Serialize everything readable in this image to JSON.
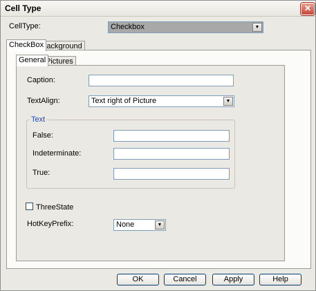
{
  "window": {
    "title": "Cell Type"
  },
  "celltype": {
    "label": "CellType:",
    "value": "Checkbox"
  },
  "outer_tabs": [
    {
      "label": "CheckBox"
    },
    {
      "label": "Background"
    }
  ],
  "inner_tabs": [
    {
      "label": "General"
    },
    {
      "label": "Pictures"
    }
  ],
  "general": {
    "caption_label": "Caption:",
    "caption_value": "",
    "textalign_label": "TextAlign:",
    "textalign_value": "Text right of Picture",
    "text_group": {
      "legend": "Text",
      "false_label": "False:",
      "false_value": "",
      "indeterminate_label": "Indeterminate:",
      "indeterminate_value": "",
      "true_label": "True:",
      "true_value": ""
    },
    "threestate_label": "ThreeState",
    "threestate_checked": false,
    "hotkey_label": "HotKeyPrefix:",
    "hotkey_value": "None"
  },
  "buttons": {
    "ok": "OK",
    "cancel": "Cancel",
    "apply": "Apply",
    "help": "Help"
  }
}
